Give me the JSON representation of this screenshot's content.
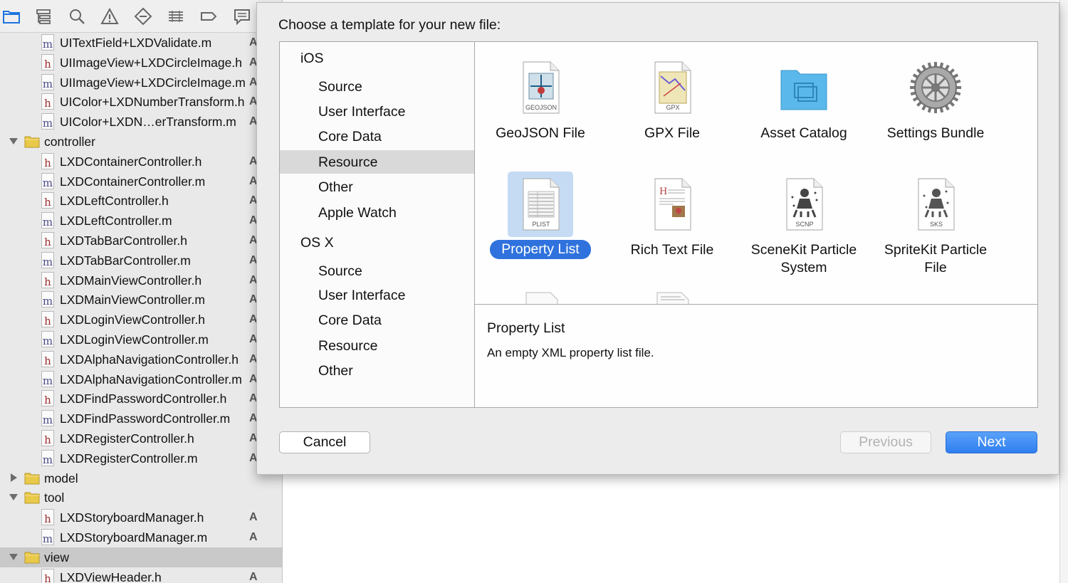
{
  "colors": {
    "accent": "#2f72dd",
    "folder": "#e9c94a",
    "header_letter": "#9b2d2d",
    "impl_letter": "#4b4b8a"
  },
  "toolbar": {
    "icons": [
      "folder-icon",
      "hierarchy-icon",
      "search-icon",
      "warning-icon",
      "test-icon",
      "debug-icon",
      "breakpoint-icon",
      "report-icon"
    ]
  },
  "navigator": {
    "rows": [
      {
        "kind": "file",
        "type": "m",
        "name": "UITextField+LXDValidate.m",
        "badge": "A"
      },
      {
        "kind": "file",
        "type": "h",
        "name": "UIImageView+LXDCircleImage.h",
        "badge": "A"
      },
      {
        "kind": "file",
        "type": "m",
        "name": "UIImageView+LXDCircleImage.m",
        "badge": "A"
      },
      {
        "kind": "file",
        "type": "h",
        "name": "UIColor+LXDNumberTransform.h",
        "badge": "A"
      },
      {
        "kind": "file",
        "type": "m",
        "name": "UIColor+LXDN…erTransform.m",
        "badge": "A"
      },
      {
        "kind": "folder",
        "name": "controller",
        "expanded": true
      },
      {
        "kind": "file",
        "type": "h",
        "name": "LXDContainerController.h",
        "badge": "A"
      },
      {
        "kind": "file",
        "type": "m",
        "name": "LXDContainerController.m",
        "badge": "A"
      },
      {
        "kind": "file",
        "type": "h",
        "name": "LXDLeftController.h",
        "badge": "A"
      },
      {
        "kind": "file",
        "type": "m",
        "name": "LXDLeftController.m",
        "badge": "A"
      },
      {
        "kind": "file",
        "type": "h",
        "name": "LXDTabBarController.h",
        "badge": "A"
      },
      {
        "kind": "file",
        "type": "m",
        "name": "LXDTabBarController.m",
        "badge": "A"
      },
      {
        "kind": "file",
        "type": "h",
        "name": "LXDMainViewController.h",
        "badge": "A"
      },
      {
        "kind": "file",
        "type": "m",
        "name": "LXDMainViewController.m",
        "badge": "A"
      },
      {
        "kind": "file",
        "type": "h",
        "name": "LXDLoginViewController.h",
        "badge": "A"
      },
      {
        "kind": "file",
        "type": "m",
        "name": "LXDLoginViewController.m",
        "badge": "A"
      },
      {
        "kind": "file",
        "type": "h",
        "name": "LXDAlphaNavigationController.h",
        "badge": "A"
      },
      {
        "kind": "file",
        "type": "m",
        "name": "LXDAlphaNavigationController.m",
        "badge": "A"
      },
      {
        "kind": "file",
        "type": "h",
        "name": "LXDFindPasswordController.h",
        "badge": "A"
      },
      {
        "kind": "file",
        "type": "m",
        "name": "LXDFindPasswordController.m",
        "badge": "A"
      },
      {
        "kind": "file",
        "type": "h",
        "name": "LXDRegisterController.h",
        "badge": "A"
      },
      {
        "kind": "file",
        "type": "m",
        "name": "LXDRegisterController.m",
        "badge": "A"
      },
      {
        "kind": "folder",
        "name": "model",
        "expanded": false
      },
      {
        "kind": "folder",
        "name": "tool",
        "expanded": true
      },
      {
        "kind": "file",
        "type": "h",
        "name": "LXDStoryboardManager.h",
        "badge": "A"
      },
      {
        "kind": "file",
        "type": "m",
        "name": "LXDStoryboardManager.m",
        "badge": "A"
      },
      {
        "kind": "folder",
        "name": "view",
        "expanded": true,
        "selected": true
      },
      {
        "kind": "file",
        "type": "h",
        "name": "LXDViewHeader.h",
        "badge": "A"
      }
    ]
  },
  "dialog": {
    "title": "Choose a template for your new file:",
    "categories": [
      {
        "kind": "platform",
        "label": "iOS"
      },
      {
        "kind": "sub",
        "label": "Source"
      },
      {
        "kind": "sub",
        "label": "User Interface"
      },
      {
        "kind": "sub",
        "label": "Core Data"
      },
      {
        "kind": "sub",
        "label": "Resource",
        "selected": true
      },
      {
        "kind": "sub",
        "label": "Other"
      },
      {
        "kind": "sub",
        "label": "Apple Watch"
      },
      {
        "kind": "platform",
        "label": "OS X"
      },
      {
        "kind": "sub",
        "label": "Source"
      },
      {
        "kind": "sub",
        "label": "User Interface"
      },
      {
        "kind": "sub",
        "label": "Core Data"
      },
      {
        "kind": "sub",
        "label": "Resource"
      },
      {
        "kind": "sub",
        "label": "Other"
      }
    ],
    "templates": [
      {
        "label": "GeoJSON File",
        "icon": "geojson-file-icon",
        "tag": "GEOJSON"
      },
      {
        "label": "GPX File",
        "icon": "gpx-file-icon",
        "tag": "GPX"
      },
      {
        "label": "Asset Catalog",
        "icon": "asset-catalog-icon",
        "tag": ""
      },
      {
        "label": "Settings Bundle",
        "icon": "settings-bundle-icon",
        "tag": ""
      },
      {
        "label": "Property List",
        "icon": "property-list-icon",
        "tag": "PLIST",
        "selected": true
      },
      {
        "label": "Rich Text File",
        "icon": "rich-text-file-icon",
        "tag": ""
      },
      {
        "label": "SceneKit Particle System",
        "icon": "scenekit-particle-icon",
        "tag": "SCNP"
      },
      {
        "label": "SpriteKit Particle File",
        "icon": "spritekit-particle-icon",
        "tag": "SKS"
      }
    ],
    "description": {
      "title": "Property List",
      "text": "An empty XML property list file."
    },
    "buttons": {
      "cancel": "Cancel",
      "previous": "Previous",
      "next": "Next"
    }
  }
}
